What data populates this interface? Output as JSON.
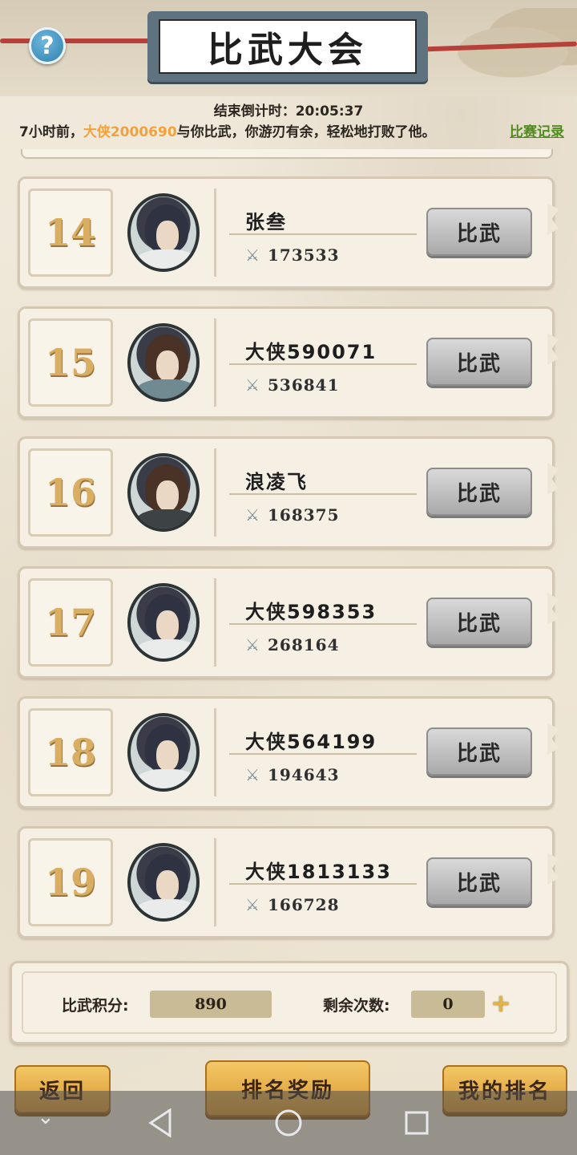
{
  "header": {
    "title": "比武大会",
    "help_icon": "?"
  },
  "countdown": {
    "label": "结束倒计时：",
    "time": "20:05:37"
  },
  "notice": {
    "prefix": "7小时前，",
    "opponent": "大侠2000690",
    "suffix": "与你比武，你游刃有余，轻松地打败了他。",
    "record_link": "比赛记录",
    "highlight_color": "#f2a23a",
    "link_color": "#4f8d1e"
  },
  "rows": [
    {
      "rank": "14",
      "name": "张叁",
      "power": "173533",
      "button": "比武"
    },
    {
      "rank": "15",
      "name": "大侠590071",
      "power": "536841",
      "button": "比武"
    },
    {
      "rank": "16",
      "name": "浪凌飞",
      "power": "168375",
      "button": "比武"
    },
    {
      "rank": "17",
      "name": "大侠598353",
      "power": "268164",
      "button": "比武"
    },
    {
      "rank": "18",
      "name": "大侠564199",
      "power": "194643",
      "button": "比武"
    },
    {
      "rank": "19",
      "name": "大侠1813133",
      "power": "166728",
      "button": "比武"
    }
  ],
  "stats": {
    "score_label": "比武积分:",
    "score_value": "890",
    "remaining_label": "剩余次数:",
    "remaining_value": "0",
    "plus_icon": "+"
  },
  "buttons": {
    "back": "返回",
    "rank_rewards": "排名奖励",
    "my_rank": "我的排名"
  },
  "navbar": {
    "icons": [
      "chevron-down-icon",
      "back-triangle-icon",
      "home-circle-icon",
      "recents-square-icon"
    ]
  }
}
